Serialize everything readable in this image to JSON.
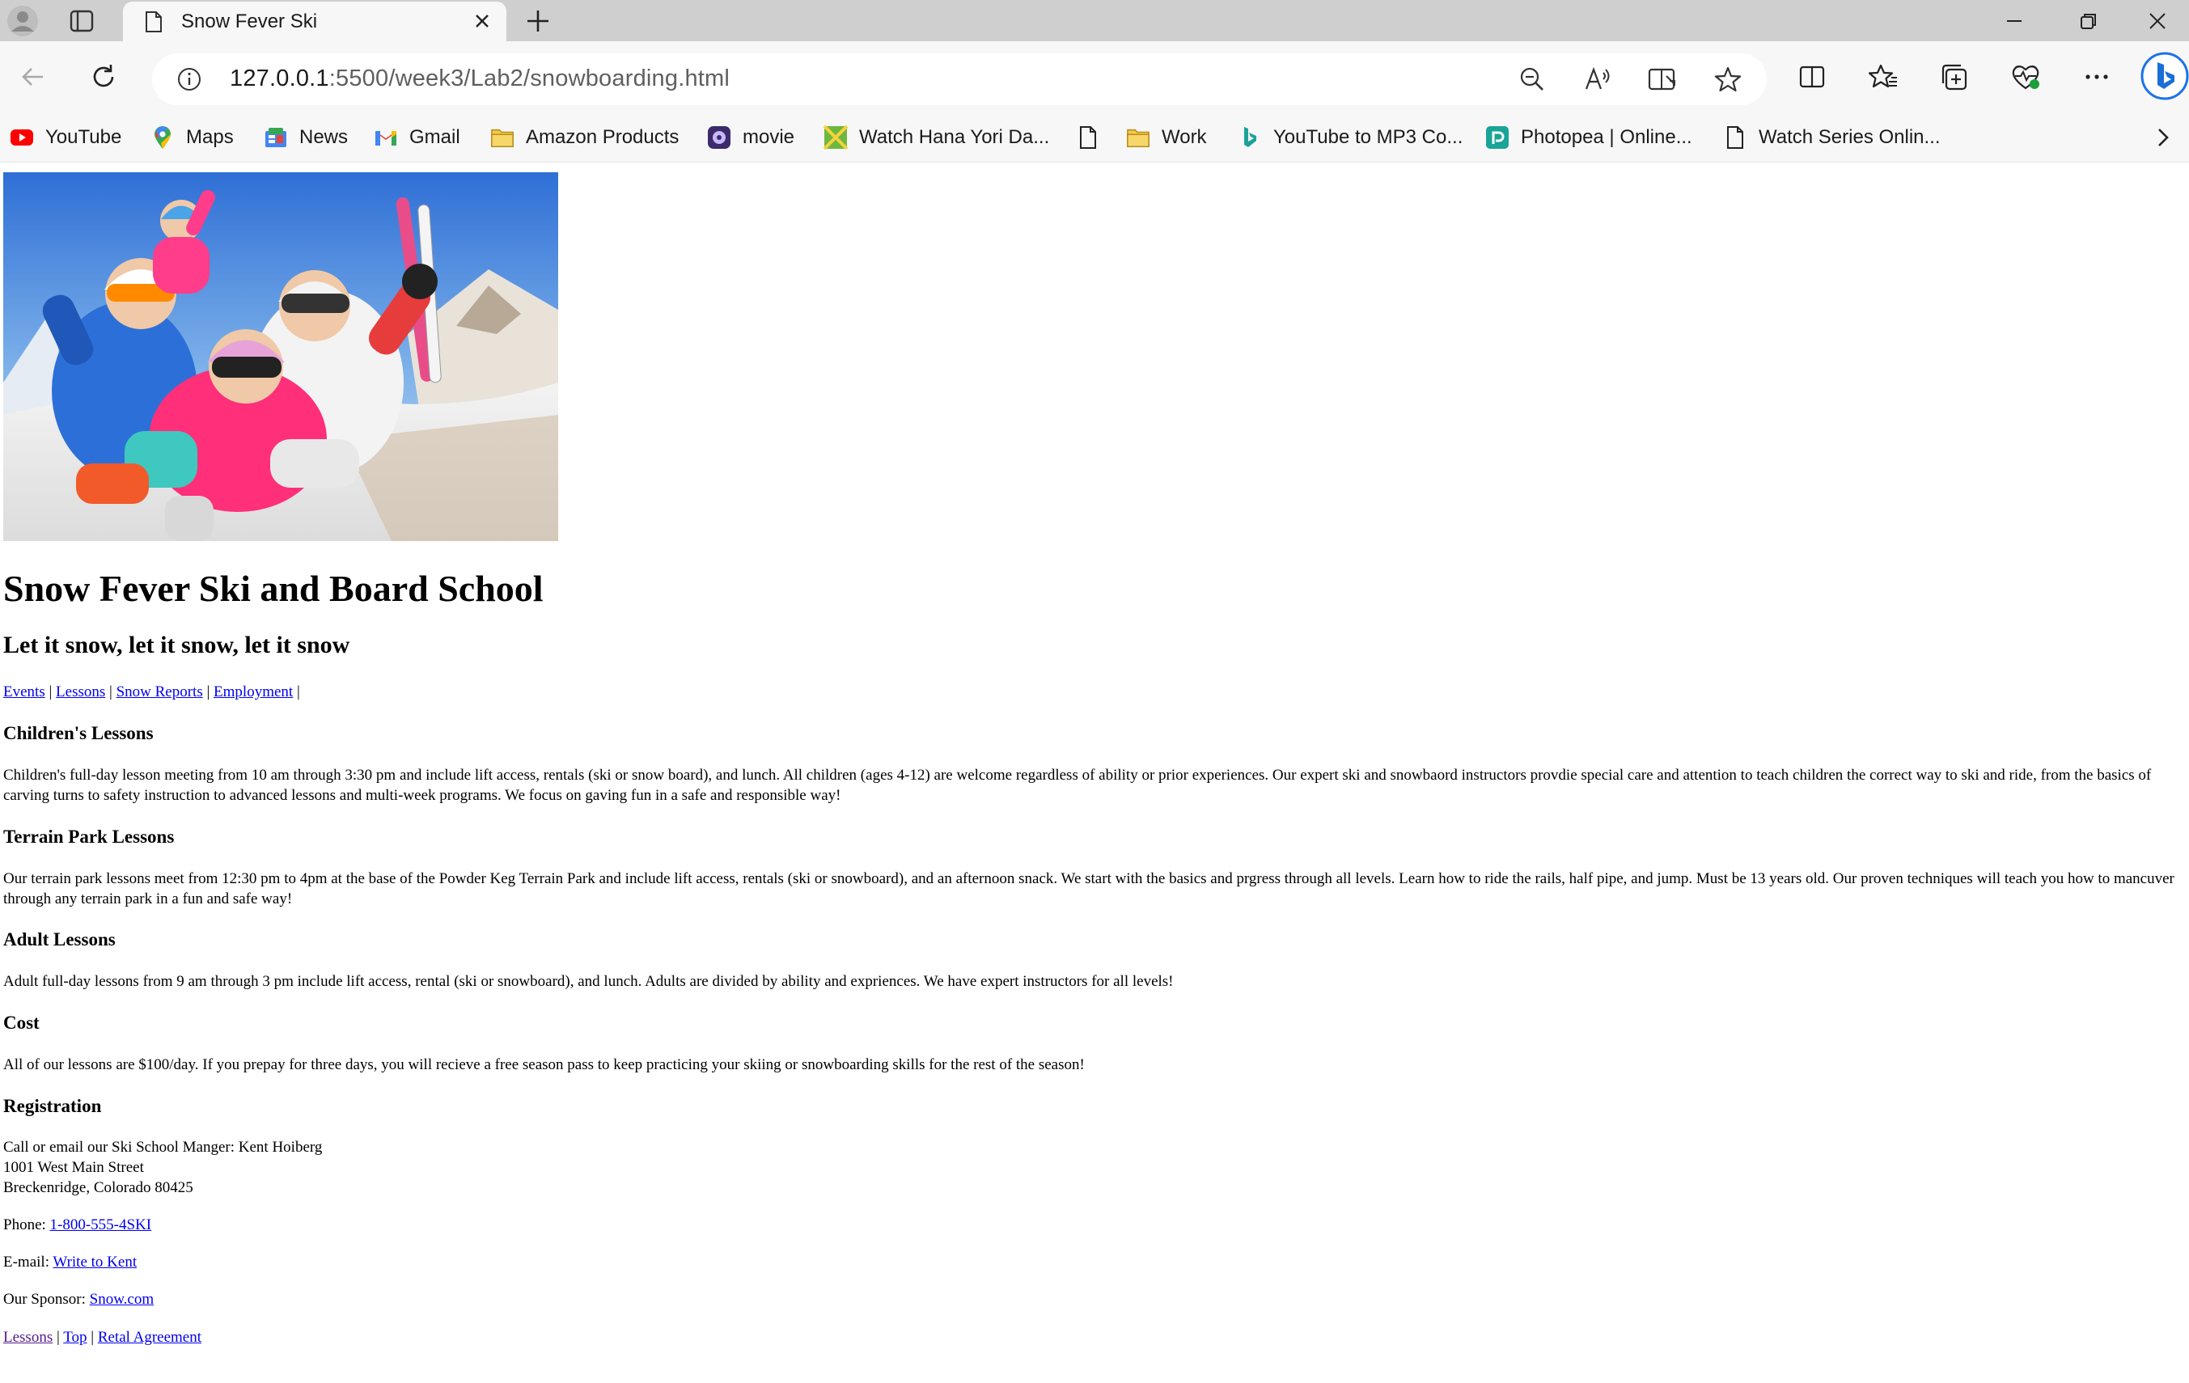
{
  "browser": {
    "tab_title": "Snow Fever Ski",
    "address_host": "127.0.0.1",
    "address_path": ":5500/week3/Lab2/snowboarding.html",
    "bookmarks": [
      {
        "label": "YouTube",
        "icon": "youtube-icon"
      },
      {
        "label": "Maps",
        "icon": "maps-icon"
      },
      {
        "label": "News",
        "icon": "news-icon"
      },
      {
        "label": "Gmail",
        "icon": "gmail-icon"
      },
      {
        "label": "Amazon Products",
        "icon": "folder-icon"
      },
      {
        "label": "movie",
        "icon": "movie-icon"
      },
      {
        "label": "Watch Hana Yori Da...",
        "icon": "site-icon"
      },
      {
        "label": "",
        "icon": "page-icon"
      },
      {
        "label": "Work",
        "icon": "folder-icon"
      },
      {
        "label": "YouTube to MP3 Co...",
        "icon": "b-icon"
      },
      {
        "label": "Photopea | Online...",
        "icon": "photopea-icon"
      },
      {
        "label": "Watch Series Onlin...",
        "icon": "page-icon"
      }
    ]
  },
  "page": {
    "title": "Snow Fever Ski and Board School",
    "subtitle": "Let it snow, let it snow, let it snow",
    "nav": [
      {
        "label": "Events"
      },
      {
        "label": "Lessons"
      },
      {
        "label": "Snow Reports"
      },
      {
        "label": "Employment"
      }
    ],
    "nav_separator": "|",
    "sections": {
      "children": {
        "heading": "Children's Lessons",
        "text": "Children's full-day lesson meeting from 10 am through 3:30 pm and include lift access, rentals (ski or snow board), and lunch. All children (ages 4-12) are welcome regardless of ability or prior experiences. Our expert ski and snowbaord instructors provdie special care and attention to teach children the correct way to ski and ride, from the basics of carving turns to safety instruction to advanced lessons and multi-week programs. We focus on gaving fun in a safe and responsible way!"
      },
      "terrain": {
        "heading": "Terrain Park Lessons",
        "text": "Our terrain park lessons meet from 12:30 pm to 4pm at the base of the Powder Keg Terrain Park and include lift access, rentals (ski or snowboard), and an afternoon snack. We start with the basics and prgress through all levels. Learn how to ride the rails, half pipe, and jump. Must be 13 years old. Our proven techniques will teach you how to mancuver through any terrain park in a fun and safe way!"
      },
      "adult": {
        "heading": "Adult Lessons",
        "text": "Adult full-day lessons from 9 am through 3 pm include lift access, rental (ski or snowboard), and lunch. Adults are divided by ability and expriences. We have expert instructors for all levels!"
      },
      "cost": {
        "heading": "Cost",
        "text": "All of our lessons are $100/day. If you prepay for three days, you will recieve a free season pass to keep practicing your skiing or snowboarding skills for the rest of the season!"
      },
      "registration": {
        "heading": "Registration",
        "address_line1": "Call or email our Ski School Manger: Kent Hoiberg",
        "address_line2": "1001 West Main Street",
        "address_line3": "Breckenridge, Colorado 80425",
        "phone_label": "Phone:",
        "phone_link": "1-800-555-4SKI",
        "email_label": "E-mail:",
        "email_link": "Write to Kent",
        "sponsor_label": "Our Sponsor:",
        "sponsor_link": "Snow.com"
      }
    },
    "footer_nav": [
      {
        "label": "Lessons",
        "visited": true
      },
      {
        "label": "Top",
        "visited": false
      },
      {
        "label": "Retal Agreement",
        "visited": false
      }
    ]
  }
}
